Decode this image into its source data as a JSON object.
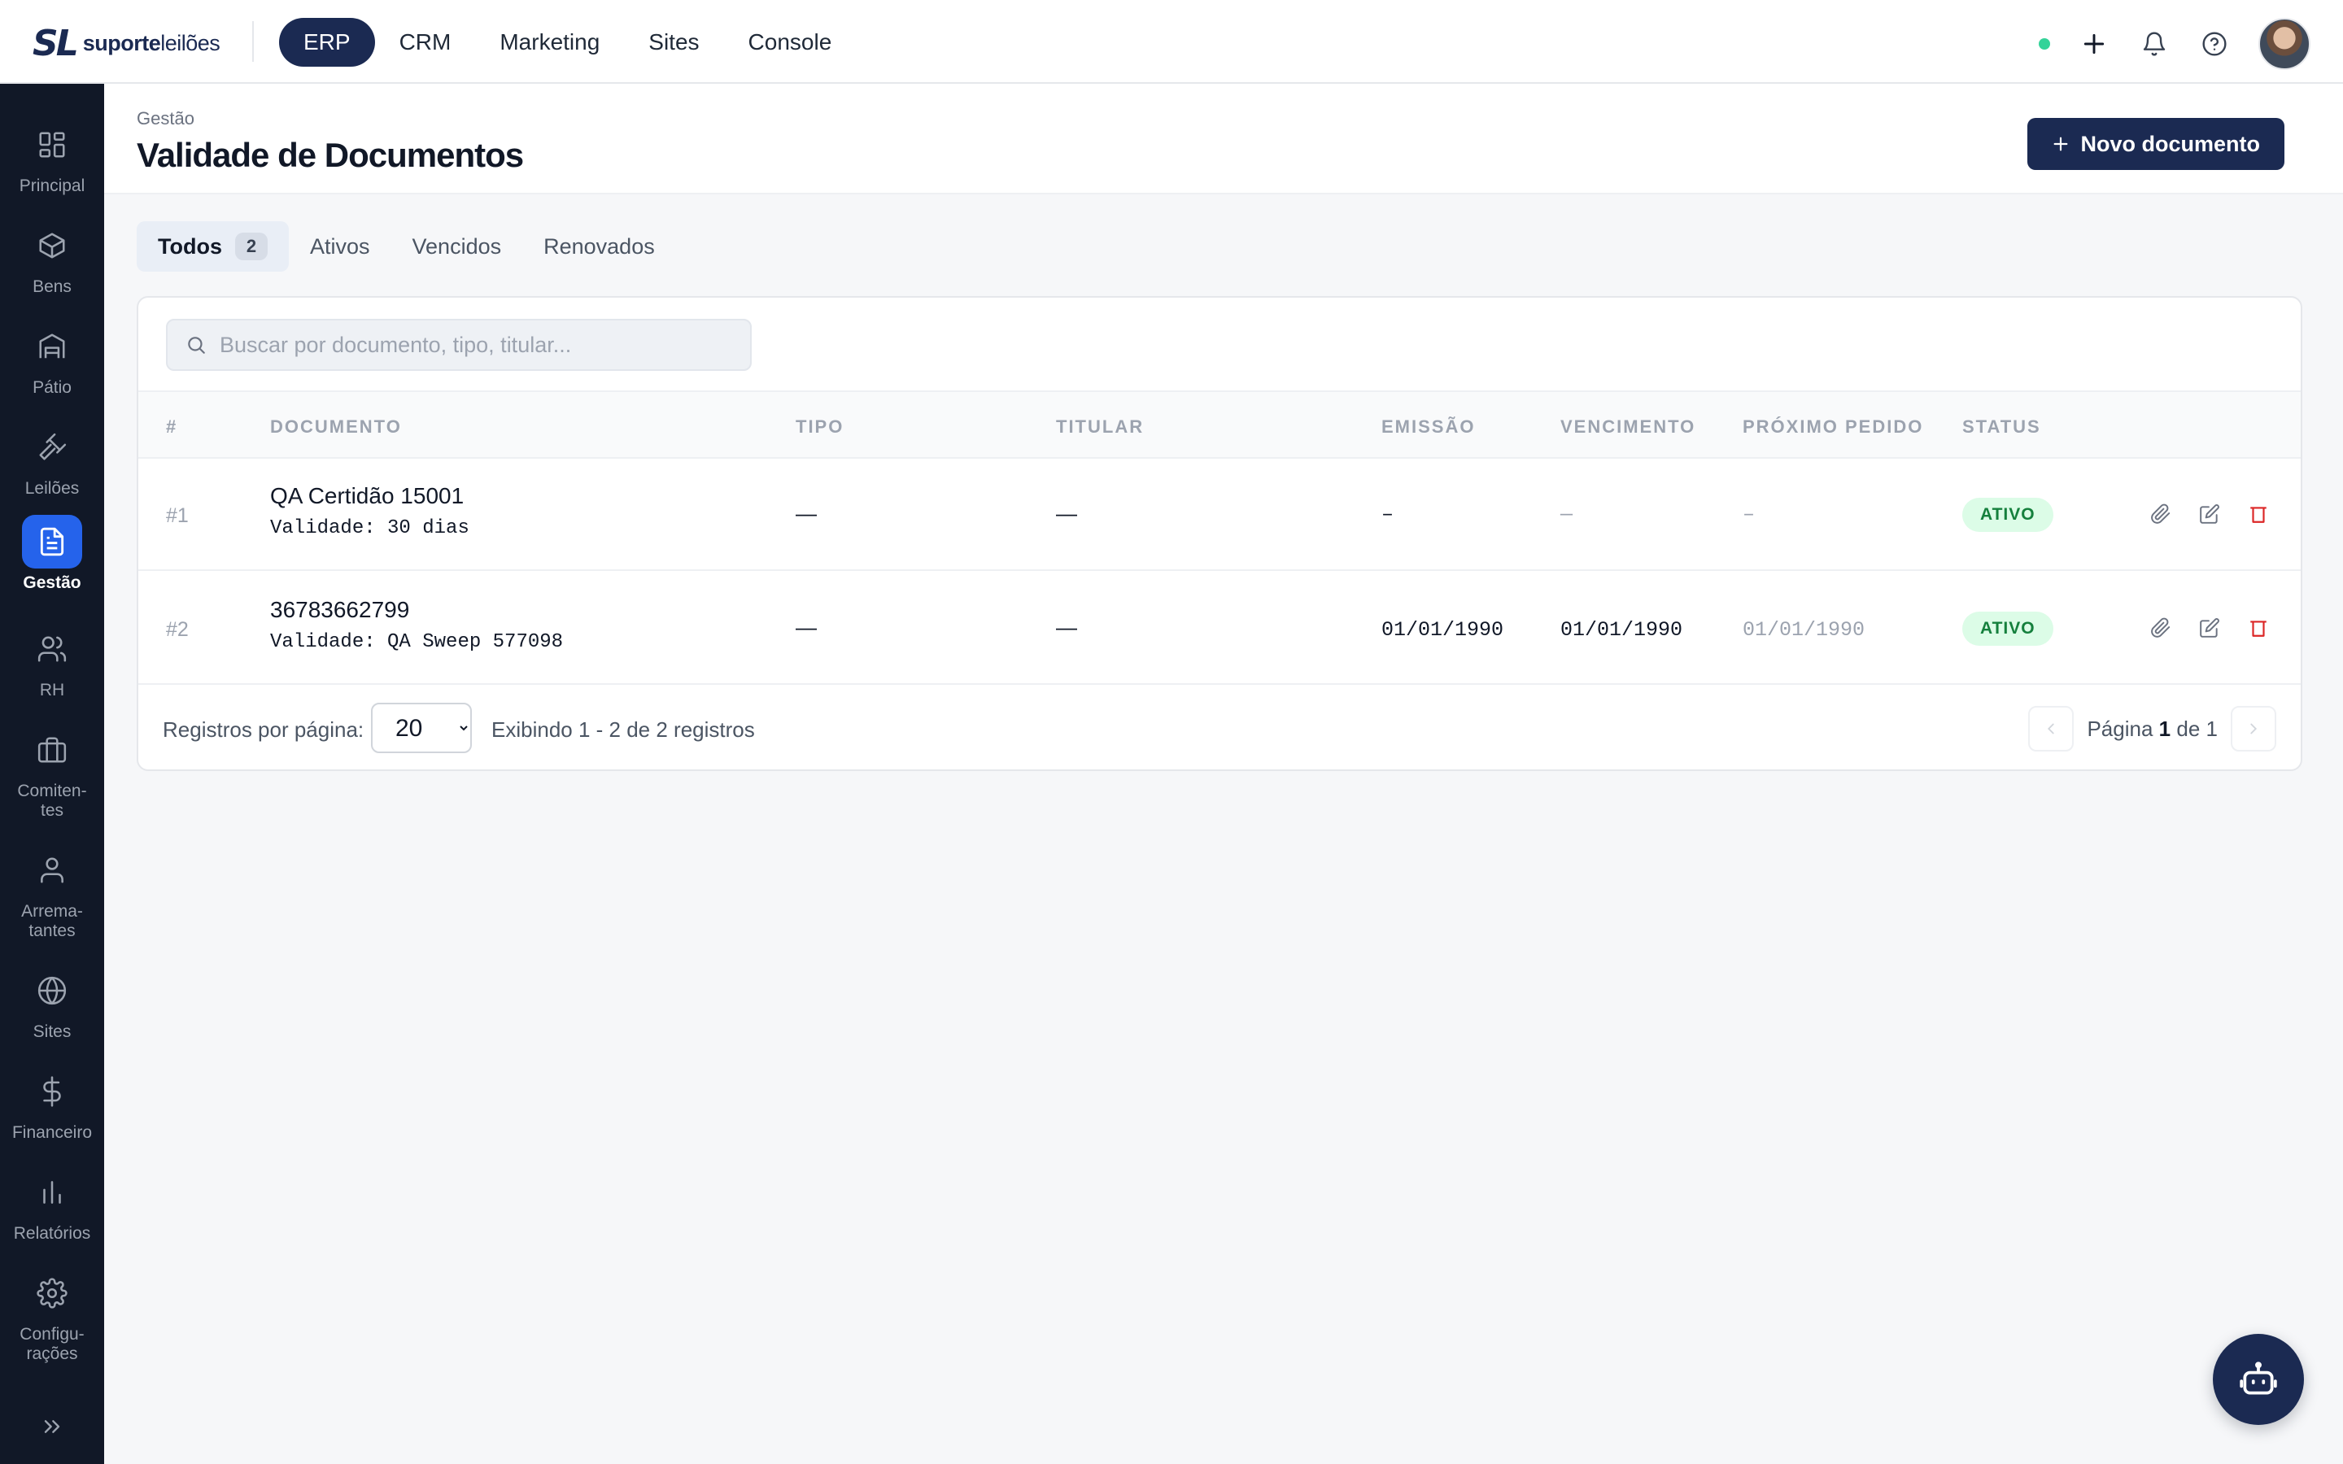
{
  "brand": {
    "mark": "SL",
    "name_bold": "suporte",
    "name_light": "leilões"
  },
  "topnav": {
    "items": [
      {
        "label": "ERP",
        "active": true
      },
      {
        "label": "CRM"
      },
      {
        "label": "Marketing"
      },
      {
        "label": "Sites"
      },
      {
        "label": "Console"
      }
    ]
  },
  "sidebar": {
    "items": [
      {
        "label": "Principal",
        "icon": "grid-icon"
      },
      {
        "label": "Bens",
        "icon": "box-icon"
      },
      {
        "label": "Pátio",
        "icon": "warehouse-icon"
      },
      {
        "label": "Leilões",
        "icon": "gavel-icon"
      },
      {
        "label": "Gestão",
        "icon": "document-icon",
        "active": true
      },
      {
        "label": "RH",
        "icon": "users-icon"
      },
      {
        "label": "Comiten-\ntes",
        "icon": "briefcase-icon"
      },
      {
        "label": "Arrema-\ntantes",
        "icon": "user-icon"
      },
      {
        "label": "Sites",
        "icon": "globe-icon"
      },
      {
        "label": "Financeiro",
        "icon": "dollar-icon"
      },
      {
        "label": "Relatórios",
        "icon": "bar-chart-icon"
      },
      {
        "label": "Configu-\nrações",
        "icon": "gear-icon"
      }
    ]
  },
  "page": {
    "breadcrumb": "Gestão",
    "title": "Validade de Documentos",
    "new_button": "Novo documento"
  },
  "tabs": [
    {
      "label": "Todos",
      "count": "2",
      "active": true
    },
    {
      "label": "Ativos"
    },
    {
      "label": "Vencidos"
    },
    {
      "label": "Renovados"
    }
  ],
  "search": {
    "placeholder": "Buscar por documento, tipo, titular...",
    "value": ""
  },
  "table": {
    "columns": [
      "#",
      "DOCUMENTO",
      "TIPO",
      "TITULAR",
      "EMISSÃO",
      "VENCIMENTO",
      "PRÓXIMO PEDIDO",
      "STATUS"
    ],
    "rows": [
      {
        "idx": "#1",
        "name": "QA Certidão 15001",
        "sub": "Validade: 30 dias",
        "tipo": "—",
        "titular": "—",
        "emissao": "–",
        "vencimento": "—",
        "proximo": "–",
        "status": "ATIVO"
      },
      {
        "idx": "#2",
        "name": "36783662799",
        "sub": "Validade: QA Sweep 577098",
        "tipo": "—",
        "titular": "—",
        "emissao": "01/01/1990",
        "vencimento": "01/01/1990",
        "proximo": "01/01/1990",
        "status": "ATIVO"
      }
    ]
  },
  "footer": {
    "per_page_label": "Registros por página:",
    "per_page_value": "20",
    "showing": "Exibindo 1 - 2 de 2 registros",
    "page_prefix": "Página",
    "page_current": "1",
    "page_of": "de",
    "page_total": "1"
  },
  "colors": {
    "brand": "#1b2a52",
    "sidebar": "#111827",
    "active_blue": "#2563eb",
    "status_green_bg": "#dcfce7",
    "status_green_text": "#15803d",
    "danger": "#dc2626"
  }
}
